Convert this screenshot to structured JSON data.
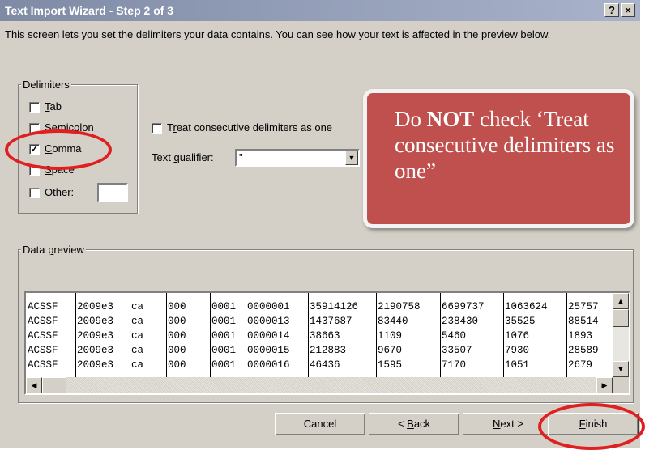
{
  "window": {
    "title": "Text Import Wizard - Step 2 of 3",
    "help_label": "?",
    "close_label": "×"
  },
  "description": "This screen lets you set the delimiters your data contains.  You can see how your text is affected in the preview below.",
  "delimiters": {
    "legend": "Delimiters",
    "tab": {
      "pre": "",
      "ul": "T",
      "post": "ab",
      "checked": false
    },
    "semicolon": {
      "pre": "Se",
      "ul": "m",
      "post": "icolon",
      "checked": false
    },
    "comma": {
      "pre": "",
      "ul": "C",
      "post": "omma",
      "checked": true
    },
    "space": {
      "pre": "",
      "ul": "S",
      "post": "pace",
      "checked": false
    },
    "other": {
      "pre": "",
      "ul": "O",
      "post": "ther:",
      "checked": false,
      "value": ""
    }
  },
  "options": {
    "treat_consecutive": {
      "pre": "T",
      "ul": "r",
      "post": "eat consecutive delimiters as one",
      "checked": false
    },
    "text_qualifier": {
      "pre": "Text ",
      "ul": "q",
      "post": "ualifier:",
      "value": "\""
    }
  },
  "callout": {
    "pre": "Do ",
    "bold": "NOT",
    "post": " check ‘Treat consecutive delimiters as one”"
  },
  "preview": {
    "legend_pre": "Data ",
    "legend_ul": "p",
    "legend_post": "review",
    "rows": [
      [
        "ACSSF",
        "2009e3",
        "ca",
        "000",
        "0001",
        "0000001",
        "35914126",
        "2190758",
        "6699737",
        "1063624",
        "25757"
      ],
      [
        "ACSSF",
        "2009e3",
        "ca",
        "000",
        "0001",
        "0000013",
        "1437687",
        "83440",
        "238430",
        "35525",
        "88514"
      ],
      [
        "ACSSF",
        "2009e3",
        "ca",
        "000",
        "0001",
        "0000014",
        "38663",
        "1109",
        "5460",
        "1076",
        "1893"
      ],
      [
        "ACSSF",
        "2009e3",
        "ca",
        "000",
        "0001",
        "0000015",
        "212883",
        "9670",
        "33507",
        "7930",
        "28589"
      ],
      [
        "ACSSF",
        "2009e3",
        "ca",
        "000",
        "0001",
        "0000016",
        "46436",
        "1595",
        "7170",
        "1051",
        "2679"
      ]
    ]
  },
  "scroll": {
    "up_icon": "▲",
    "down_icon": "▼",
    "left_icon": "◀",
    "right_icon": "▶",
    "dropdown_icon": "▼"
  },
  "buttons": {
    "cancel": {
      "pre": "Cancel",
      "ul": "",
      "post": ""
    },
    "back": {
      "pre": "< ",
      "ul": "B",
      "post": "ack"
    },
    "next": {
      "pre": "",
      "ul": "N",
      "post": "ext >"
    },
    "finish": {
      "pre": "",
      "ul": "F",
      "post": "inish"
    }
  },
  "colors": {
    "callout_fill": "#c0504d",
    "highlight_ring": "#e02020",
    "title_bar": "#8a96b2"
  }
}
